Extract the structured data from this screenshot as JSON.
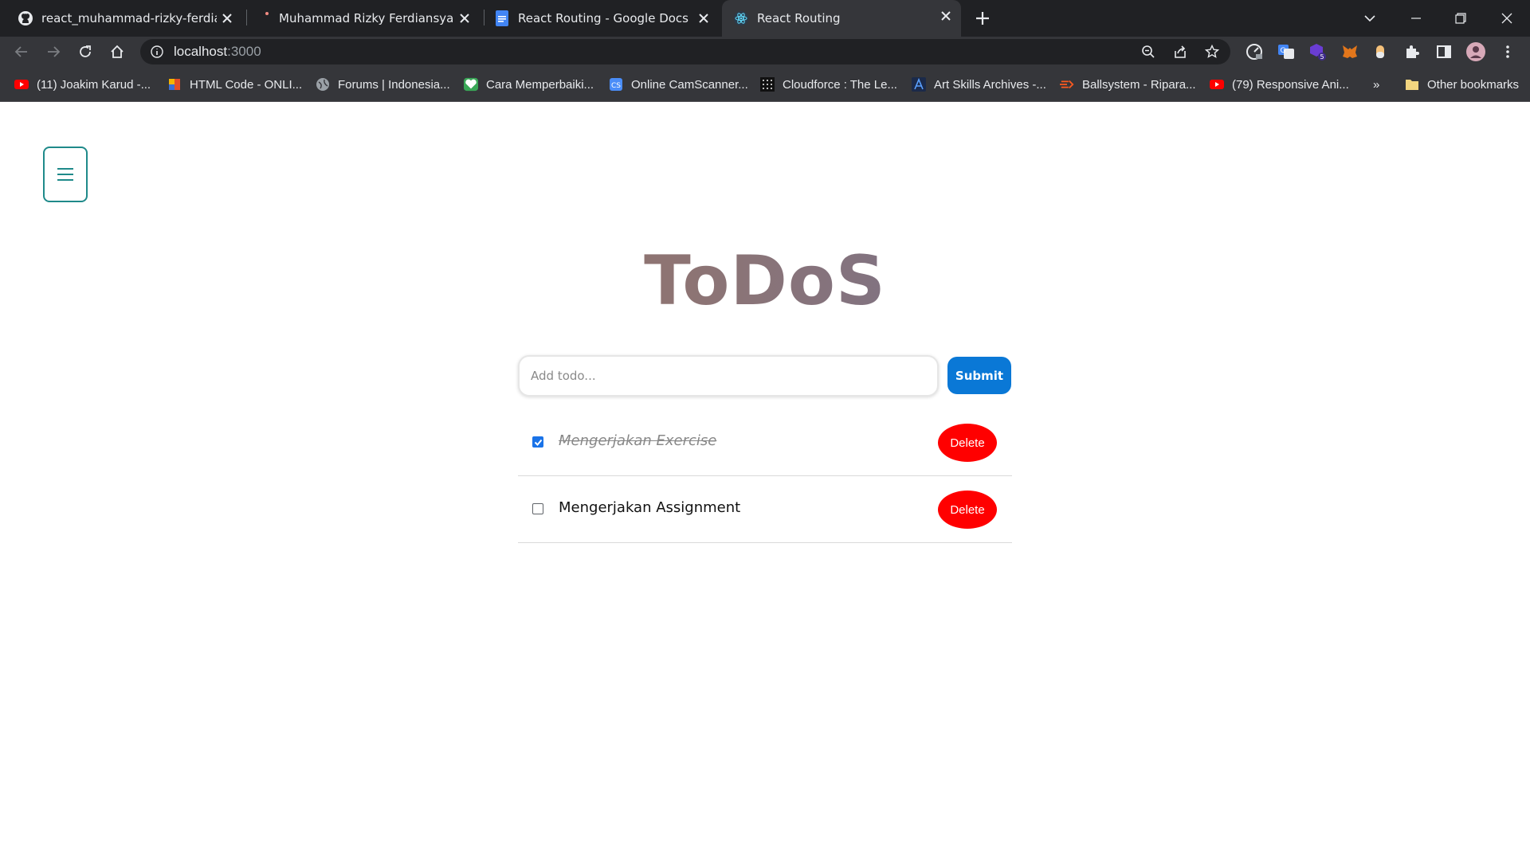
{
  "browser": {
    "tabs": [
      {
        "title": "react_muhammad-rizky-ferdiansyah",
        "icon": "github-icon"
      },
      {
        "title": "Muhammad Rizky Ferdiansyah -",
        "icon": "unsaved-dot-icon"
      },
      {
        "title": "React Routing - Google Docs",
        "icon": "google-docs-icon"
      },
      {
        "title": "React Routing",
        "icon": "react-icon"
      }
    ],
    "url_host": "localhost",
    "url_port": ":3000",
    "bookmarks": [
      {
        "label": "(11) Joakim Karud -...",
        "icon": "youtube-icon"
      },
      {
        "label": "HTML Code - ONLI...",
        "icon": "html-icon"
      },
      {
        "label": "Forums | Indonesia...",
        "icon": "globe-icon"
      },
      {
        "label": "Cara Memperbaiki...",
        "icon": "heart-icon"
      },
      {
        "label": "Online CamScanner...",
        "icon": "camscanner-icon"
      },
      {
        "label": "Cloudforce : The Le...",
        "icon": "grid-icon"
      },
      {
        "label": "Art Skills Archives -...",
        "icon": "art-icon"
      },
      {
        "label": "Ballsystem - Ripara...",
        "icon": "ballsystem-icon"
      },
      {
        "label": "(79) Responsive Ani...",
        "icon": "youtube-icon"
      }
    ],
    "more_bookmarks": "»",
    "other_bookmarks": "Other bookmarks",
    "colors": {
      "tabbar": "#202124",
      "toolbar": "#35363a"
    }
  },
  "page": {
    "title": "ToDoS",
    "input_placeholder": "Add todo...",
    "input_value": "",
    "submit_label": "Submit",
    "todos": [
      {
        "text": "Mengerjakan Exercise",
        "completed": true,
        "delete_label": "Delete"
      },
      {
        "text": "Mengerjakan Assignment",
        "completed": false,
        "delete_label": "Delete"
      }
    ],
    "colors": {
      "accent": "#0a78d6",
      "delete": "#ff0000",
      "menu_border": "#1f8a8a"
    }
  }
}
